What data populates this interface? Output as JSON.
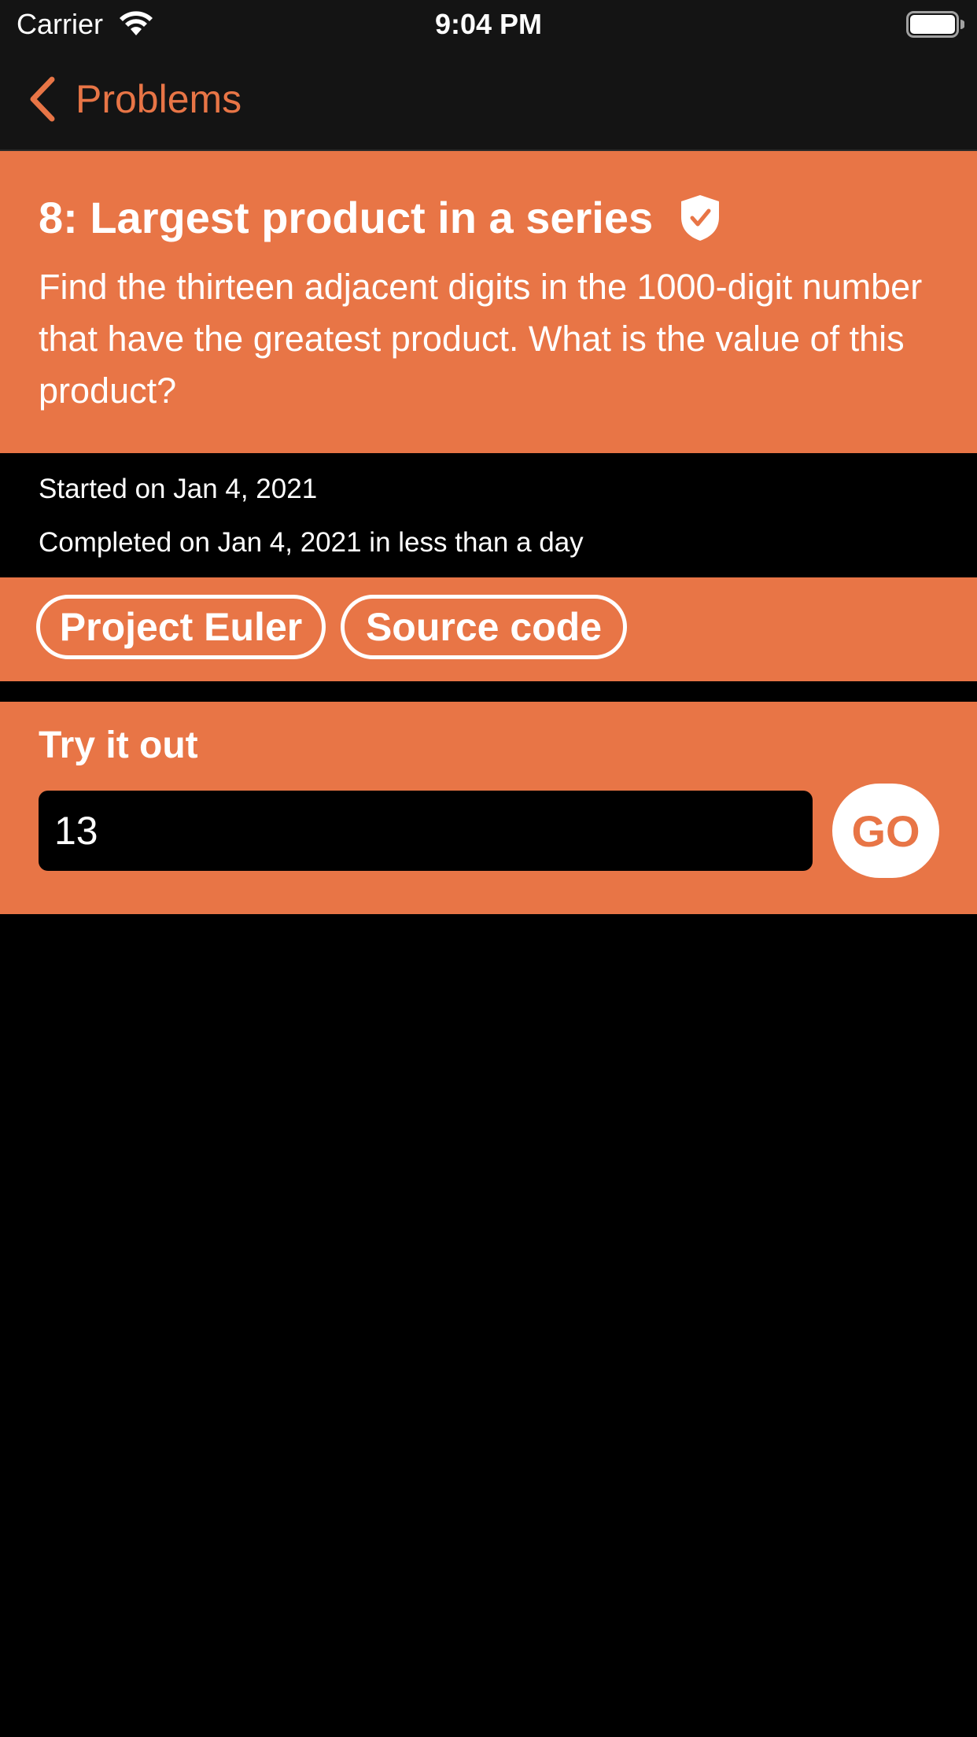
{
  "status_bar": {
    "carrier": "Carrier",
    "time": "9:04 PM"
  },
  "nav": {
    "back_label": "Problems"
  },
  "problem": {
    "title": "8: Largest product in a series",
    "description": "Find the thirteen adjacent digits in the 1000-digit number that have the greatest product. What is the value of this product?",
    "started": "Started on Jan 4, 2021",
    "completed": "Completed on Jan 4, 2021 in less than a day"
  },
  "links": {
    "project_euler": "Project Euler",
    "source_code": "Source code"
  },
  "try_it": {
    "title": "Try it out",
    "input_value": "13",
    "go_label": "GO"
  },
  "colors": {
    "accent": "#e87546",
    "background": "#000000",
    "bar": "#141414"
  }
}
